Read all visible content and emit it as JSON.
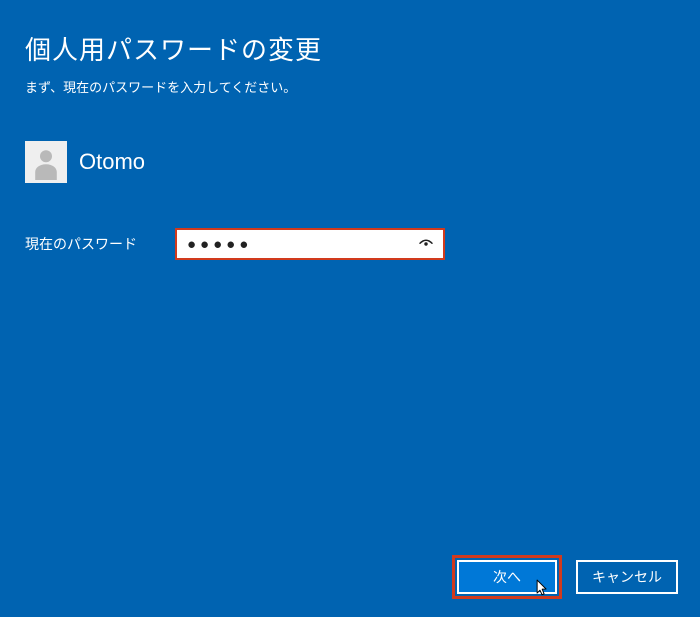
{
  "header": {
    "title": "個人用パスワードの変更",
    "subtitle": "まず、現在のパスワードを入力してください。"
  },
  "user": {
    "name": "Otomo"
  },
  "form": {
    "current_password_label": "現在のパスワード",
    "current_password_value": "●●●●●"
  },
  "buttons": {
    "next": "次へ",
    "cancel": "キャンセル"
  }
}
